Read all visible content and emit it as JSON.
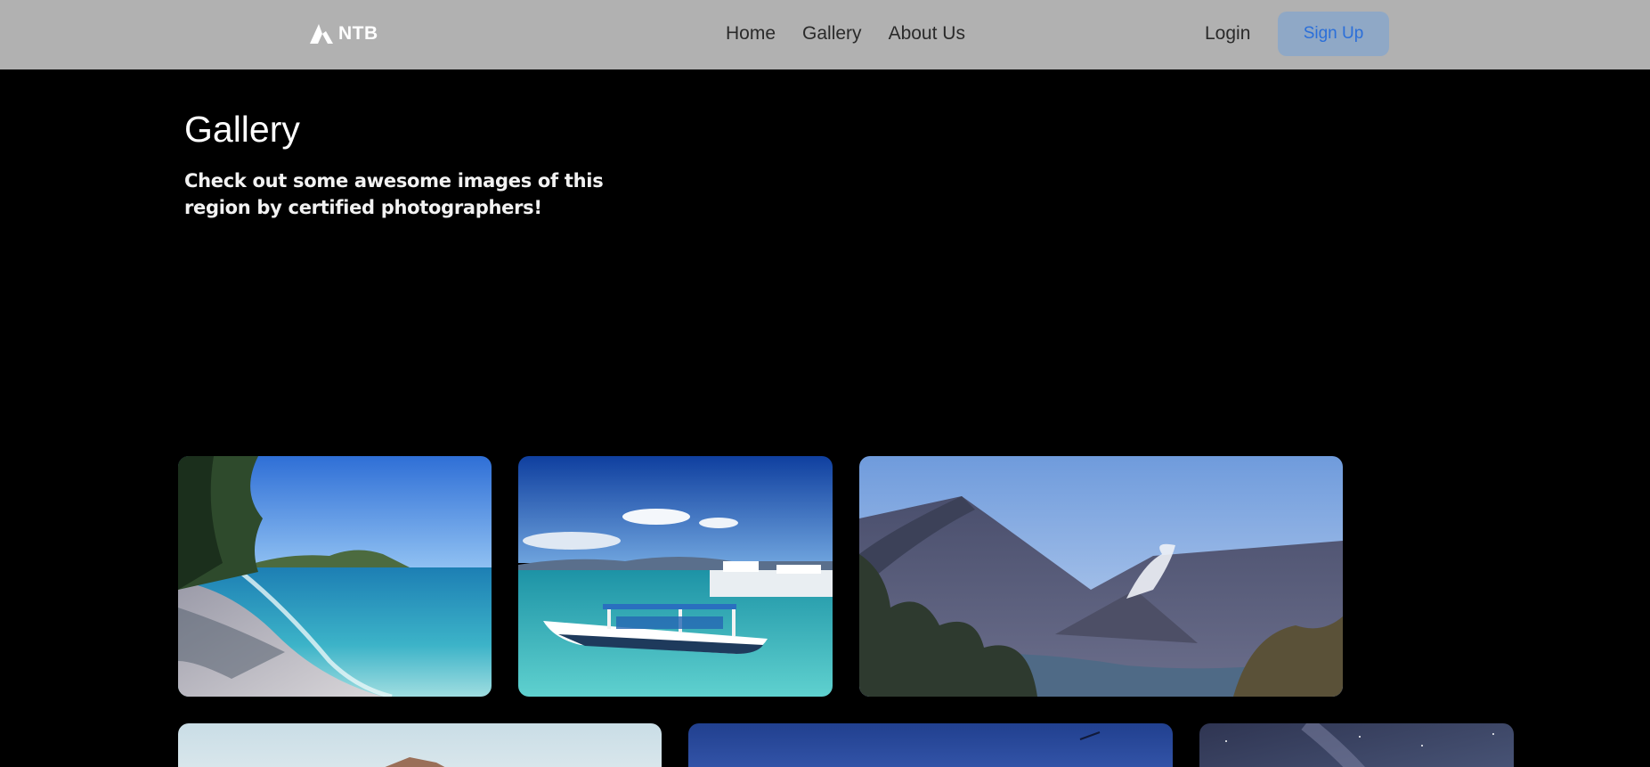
{
  "navbar": {
    "brand": "NTB",
    "links": [
      {
        "label": "Home"
      },
      {
        "label": "Gallery"
      },
      {
        "label": "About Us"
      }
    ],
    "login_label": "Login",
    "signup_label": "Sign Up"
  },
  "header": {
    "title": "Gallery",
    "subtitle": "Check out some awesome images of this region by certified photographers!"
  },
  "icons": {
    "brand_logo": "mountain-logo-icon"
  },
  "colors": {
    "navbar_bg": "#b1b1b1",
    "signup_bg": "#8fa8c6",
    "signup_text": "#2b6fd9",
    "page_bg": "#000000"
  }
}
